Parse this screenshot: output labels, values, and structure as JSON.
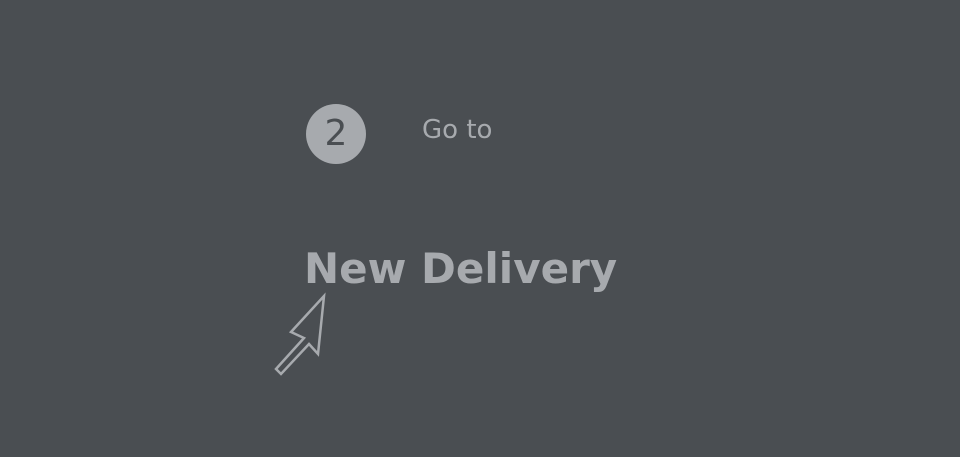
{
  "colors": {
    "background": "#4a4e52",
    "badge_fill": "#a7aaae",
    "badge_text": "#4a4e52",
    "text": "#a7aaae",
    "cursor_stroke": "#a7aaae"
  },
  "step": {
    "number": "2",
    "instruction": "Go to"
  },
  "target": {
    "label": "New Delivery"
  },
  "cursor": {
    "icon": "arrow-cursor-icon"
  }
}
